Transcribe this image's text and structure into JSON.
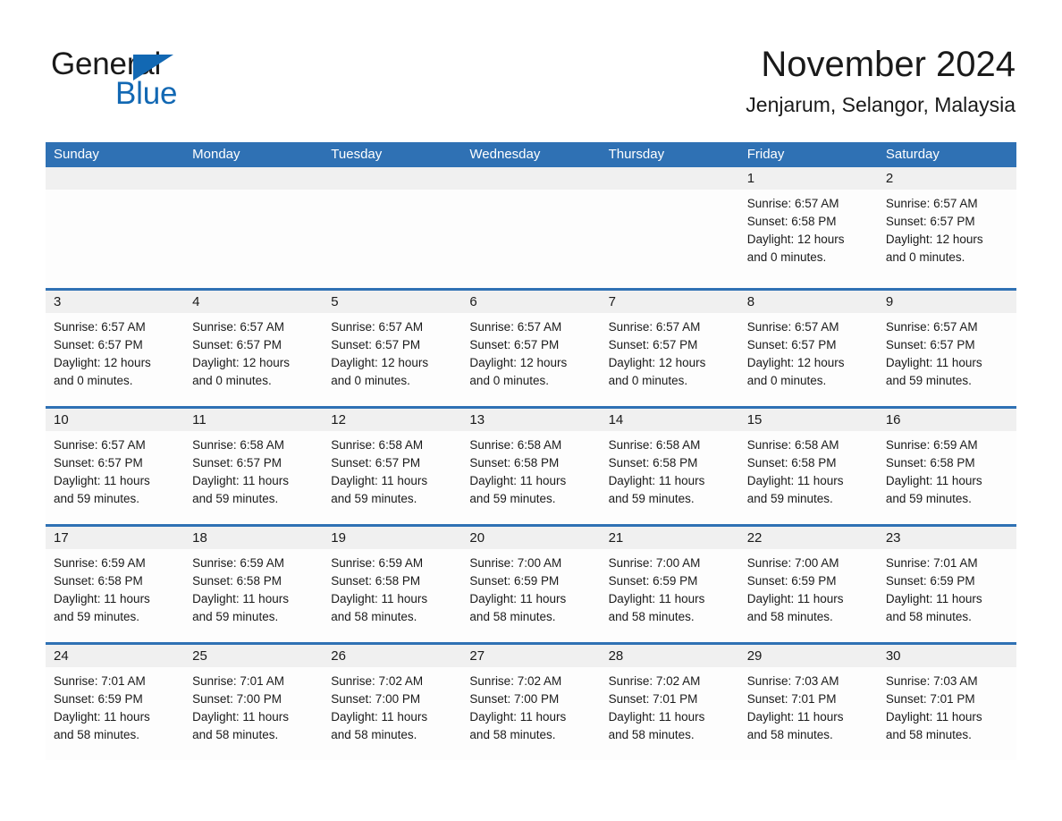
{
  "logo": {
    "word1": "General",
    "word2": "Blue",
    "triangle_color": "#1268b3",
    "icon": "triangle-icon"
  },
  "header": {
    "month_title": "November 2024",
    "location": "Jenjarum, Selangor, Malaysia"
  },
  "calendar": {
    "header_color": "#2f71b4",
    "daynum_band_color": "#f0f0f0",
    "weekdays": [
      "Sunday",
      "Monday",
      "Tuesday",
      "Wednesday",
      "Thursday",
      "Friday",
      "Saturday"
    ],
    "weeks": [
      [
        {
          "day": "",
          "lines": []
        },
        {
          "day": "",
          "lines": []
        },
        {
          "day": "",
          "lines": []
        },
        {
          "day": "",
          "lines": []
        },
        {
          "day": "",
          "lines": []
        },
        {
          "day": "1",
          "lines": [
            "Sunrise: 6:57 AM",
            "Sunset: 6:58 PM",
            "Daylight: 12 hours",
            "and 0 minutes."
          ]
        },
        {
          "day": "2",
          "lines": [
            "Sunrise: 6:57 AM",
            "Sunset: 6:57 PM",
            "Daylight: 12 hours",
            "and 0 minutes."
          ]
        }
      ],
      [
        {
          "day": "3",
          "lines": [
            "Sunrise: 6:57 AM",
            "Sunset: 6:57 PM",
            "Daylight: 12 hours",
            "and 0 minutes."
          ]
        },
        {
          "day": "4",
          "lines": [
            "Sunrise: 6:57 AM",
            "Sunset: 6:57 PM",
            "Daylight: 12 hours",
            "and 0 minutes."
          ]
        },
        {
          "day": "5",
          "lines": [
            "Sunrise: 6:57 AM",
            "Sunset: 6:57 PM",
            "Daylight: 12 hours",
            "and 0 minutes."
          ]
        },
        {
          "day": "6",
          "lines": [
            "Sunrise: 6:57 AM",
            "Sunset: 6:57 PM",
            "Daylight: 12 hours",
            "and 0 minutes."
          ]
        },
        {
          "day": "7",
          "lines": [
            "Sunrise: 6:57 AM",
            "Sunset: 6:57 PM",
            "Daylight: 12 hours",
            "and 0 minutes."
          ]
        },
        {
          "day": "8",
          "lines": [
            "Sunrise: 6:57 AM",
            "Sunset: 6:57 PM",
            "Daylight: 12 hours",
            "and 0 minutes."
          ]
        },
        {
          "day": "9",
          "lines": [
            "Sunrise: 6:57 AM",
            "Sunset: 6:57 PM",
            "Daylight: 11 hours",
            "and 59 minutes."
          ]
        }
      ],
      [
        {
          "day": "10",
          "lines": [
            "Sunrise: 6:57 AM",
            "Sunset: 6:57 PM",
            "Daylight: 11 hours",
            "and 59 minutes."
          ]
        },
        {
          "day": "11",
          "lines": [
            "Sunrise: 6:58 AM",
            "Sunset: 6:57 PM",
            "Daylight: 11 hours",
            "and 59 minutes."
          ]
        },
        {
          "day": "12",
          "lines": [
            "Sunrise: 6:58 AM",
            "Sunset: 6:57 PM",
            "Daylight: 11 hours",
            "and 59 minutes."
          ]
        },
        {
          "day": "13",
          "lines": [
            "Sunrise: 6:58 AM",
            "Sunset: 6:58 PM",
            "Daylight: 11 hours",
            "and 59 minutes."
          ]
        },
        {
          "day": "14",
          "lines": [
            "Sunrise: 6:58 AM",
            "Sunset: 6:58 PM",
            "Daylight: 11 hours",
            "and 59 minutes."
          ]
        },
        {
          "day": "15",
          "lines": [
            "Sunrise: 6:58 AM",
            "Sunset: 6:58 PM",
            "Daylight: 11 hours",
            "and 59 minutes."
          ]
        },
        {
          "day": "16",
          "lines": [
            "Sunrise: 6:59 AM",
            "Sunset: 6:58 PM",
            "Daylight: 11 hours",
            "and 59 minutes."
          ]
        }
      ],
      [
        {
          "day": "17",
          "lines": [
            "Sunrise: 6:59 AM",
            "Sunset: 6:58 PM",
            "Daylight: 11 hours",
            "and 59 minutes."
          ]
        },
        {
          "day": "18",
          "lines": [
            "Sunrise: 6:59 AM",
            "Sunset: 6:58 PM",
            "Daylight: 11 hours",
            "and 59 minutes."
          ]
        },
        {
          "day": "19",
          "lines": [
            "Sunrise: 6:59 AM",
            "Sunset: 6:58 PM",
            "Daylight: 11 hours",
            "and 58 minutes."
          ]
        },
        {
          "day": "20",
          "lines": [
            "Sunrise: 7:00 AM",
            "Sunset: 6:59 PM",
            "Daylight: 11 hours",
            "and 58 minutes."
          ]
        },
        {
          "day": "21",
          "lines": [
            "Sunrise: 7:00 AM",
            "Sunset: 6:59 PM",
            "Daylight: 11 hours",
            "and 58 minutes."
          ]
        },
        {
          "day": "22",
          "lines": [
            "Sunrise: 7:00 AM",
            "Sunset: 6:59 PM",
            "Daylight: 11 hours",
            "and 58 minutes."
          ]
        },
        {
          "day": "23",
          "lines": [
            "Sunrise: 7:01 AM",
            "Sunset: 6:59 PM",
            "Daylight: 11 hours",
            "and 58 minutes."
          ]
        }
      ],
      [
        {
          "day": "24",
          "lines": [
            "Sunrise: 7:01 AM",
            "Sunset: 6:59 PM",
            "Daylight: 11 hours",
            "and 58 minutes."
          ]
        },
        {
          "day": "25",
          "lines": [
            "Sunrise: 7:01 AM",
            "Sunset: 7:00 PM",
            "Daylight: 11 hours",
            "and 58 minutes."
          ]
        },
        {
          "day": "26",
          "lines": [
            "Sunrise: 7:02 AM",
            "Sunset: 7:00 PM",
            "Daylight: 11 hours",
            "and 58 minutes."
          ]
        },
        {
          "day": "27",
          "lines": [
            "Sunrise: 7:02 AM",
            "Sunset: 7:00 PM",
            "Daylight: 11 hours",
            "and 58 minutes."
          ]
        },
        {
          "day": "28",
          "lines": [
            "Sunrise: 7:02 AM",
            "Sunset: 7:01 PM",
            "Daylight: 11 hours",
            "and 58 minutes."
          ]
        },
        {
          "day": "29",
          "lines": [
            "Sunrise: 7:03 AM",
            "Sunset: 7:01 PM",
            "Daylight: 11 hours",
            "and 58 minutes."
          ]
        },
        {
          "day": "30",
          "lines": [
            "Sunrise: 7:03 AM",
            "Sunset: 7:01 PM",
            "Daylight: 11 hours",
            "and 58 minutes."
          ]
        }
      ]
    ]
  }
}
